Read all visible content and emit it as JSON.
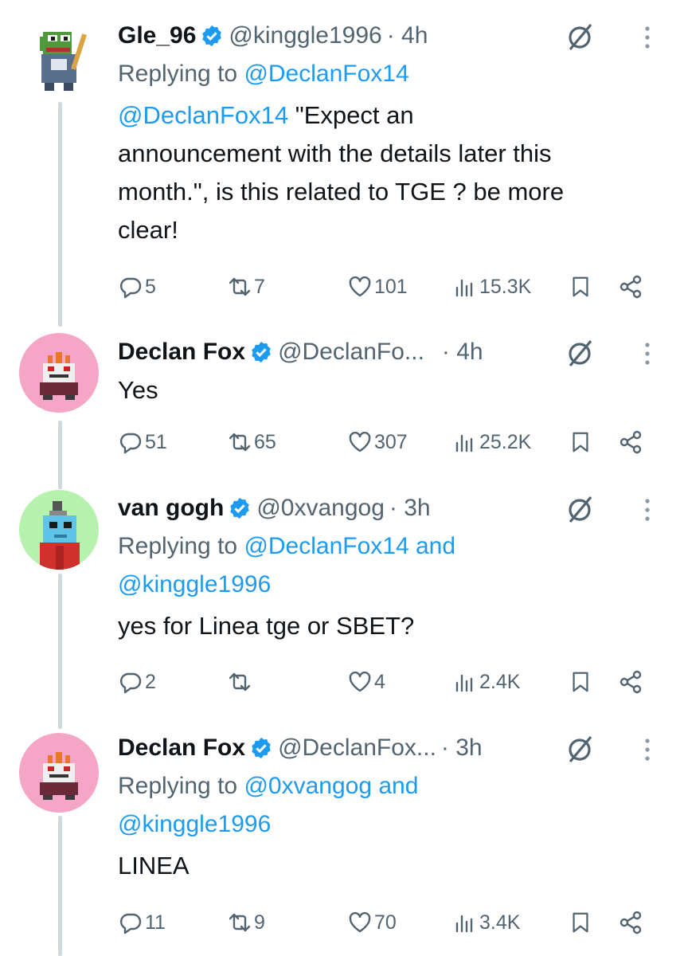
{
  "tweets": [
    {
      "name": "Gle_96",
      "handle": "@kinggle1996",
      "time": "· 4h",
      "replying_prefix": "Replying to ",
      "replying_to": [
        "@DeclanFox14"
      ],
      "replying_and": "",
      "text_mention": "@DeclanFox14",
      "text_lines": [
        " \"Expect an",
        "announcement with the details later this",
        "month.\", is this related to TGE ? be more",
        "clear!"
      ],
      "stats": {
        "replies": "5",
        "retweets": "7",
        "likes": "101",
        "views": "15.3K"
      }
    },
    {
      "name": "Declan Fox",
      "handle": "@DeclanFo...",
      "time": "· 4h",
      "text": "Yes",
      "stats": {
        "replies": "51",
        "retweets": "65",
        "likes": "307",
        "views": "25.2K"
      }
    },
    {
      "name": "van gogh",
      "handle": "@0xvangog",
      "time": "· 3h",
      "replying_prefix": "Replying to ",
      "replying_line1": "@DeclanFox14 and",
      "replying_line2": "@kinggle1996",
      "text": "yes for Linea tge or SBET?",
      "stats": {
        "replies": "2",
        "retweets": "",
        "likes": "4",
        "views": "2.4K"
      }
    },
    {
      "name": "Declan Fox",
      "handle": "@DeclanFox...",
      "time": "· 3h",
      "replying_prefix": "Replying to ",
      "replying_line1": "@0xvangog and",
      "replying_line2": "@kinggle1996",
      "text": "LINEA",
      "stats": {
        "replies": "11",
        "retweets": "9",
        "likes": "70",
        "views": "3.4K"
      }
    }
  ],
  "icons": {
    "verified": "verified-badge-icon",
    "mark": "grok-mark-icon",
    "more": "more-vertical-icon",
    "reply": "reply-bubble-icon",
    "retweet": "retweet-icon",
    "like": "heart-icon",
    "views": "views-bar-icon",
    "bookmark": "bookmark-icon",
    "share": "share-icon"
  },
  "colors": {
    "link": "#1d9bf0",
    "secondary": "#536471",
    "verified": "#1d9bf0",
    "thread_line": "#cfd9de"
  }
}
